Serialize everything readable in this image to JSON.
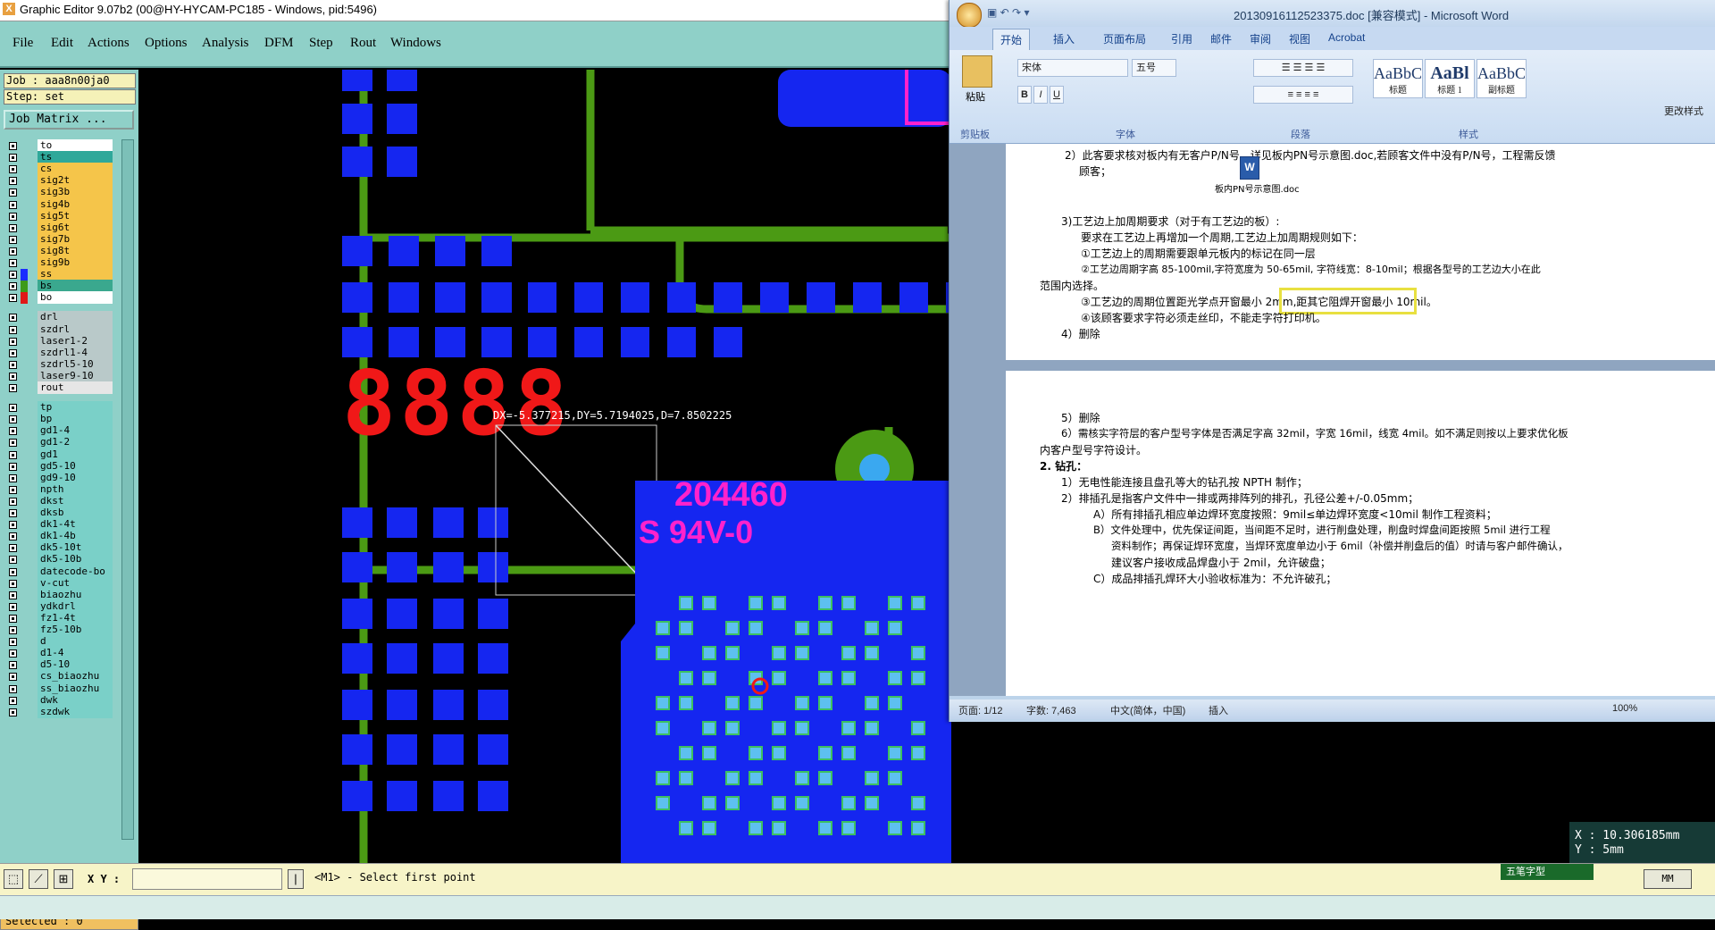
{
  "graphic_editor": {
    "title": "Graphic Editor 9.07b2 (00@HY-HYCAM-PC185 - Windows, pid:5496)",
    "menu": [
      "File",
      "Edit",
      "Actions",
      "Options",
      "Analysis",
      "DFM",
      "Step",
      "Rout",
      "Windows"
    ],
    "job": "Job : aaa8n00ja0",
    "step": "Step: set",
    "job_matrix_label": "Job Matrix ...",
    "layers_group1": [
      {
        "name": "to",
        "color": "#ffffff",
        "swatch": ""
      },
      {
        "name": "ts",
        "color": "#2fa89a",
        "swatch": ""
      },
      {
        "name": "cs",
        "color": "#f5c54a",
        "swatch": ""
      },
      {
        "name": "sig2t",
        "color": "#f5c54a",
        "swatch": ""
      },
      {
        "name": "sig3b",
        "color": "#f5c54a",
        "swatch": ""
      },
      {
        "name": "sig4b",
        "color": "#f5c54a",
        "swatch": ""
      },
      {
        "name": "sig5t",
        "color": "#f5c54a",
        "swatch": ""
      },
      {
        "name": "sig6t",
        "color": "#f5c54a",
        "swatch": ""
      },
      {
        "name": "sig7b",
        "color": "#f5c54a",
        "swatch": ""
      },
      {
        "name": "sig8t",
        "color": "#f5c54a",
        "swatch": ""
      },
      {
        "name": "sig9b",
        "color": "#f5c54a",
        "swatch": ""
      },
      {
        "name": "ss",
        "color": "#f5c54a",
        "swatch": "#1a2cff"
      },
      {
        "name": "bs",
        "color": "#3aa88e",
        "swatch": "#3d9a1a"
      },
      {
        "name": "bo",
        "color": "#ffffff",
        "swatch": "#e01818"
      }
    ],
    "layers_group2": [
      {
        "name": "drl",
        "color": "#b9c9c9"
      },
      {
        "name": "szdrl",
        "color": "#b9c9c9"
      },
      {
        "name": "laser1-2",
        "color": "#b9c9c9"
      },
      {
        "name": "szdrl1-4",
        "color": "#b9c9c9"
      },
      {
        "name": "szdrl5-10",
        "color": "#b9c9c9"
      },
      {
        "name": "laser9-10",
        "color": "#b9c9c9"
      },
      {
        "name": "rout",
        "color": "#e6e6e6"
      }
    ],
    "layers_group3": [
      {
        "name": "tp"
      },
      {
        "name": "bp"
      },
      {
        "name": "gd1-4"
      },
      {
        "name": "gd1-2"
      },
      {
        "name": "gd1"
      },
      {
        "name": "gd5-10"
      },
      {
        "name": "gd9-10"
      },
      {
        "name": "npth"
      },
      {
        "name": "dkst"
      },
      {
        "name": "dksb"
      },
      {
        "name": "dk1-4t"
      },
      {
        "name": "dk1-4b"
      },
      {
        "name": "dk5-10t"
      },
      {
        "name": "dk5-10b"
      },
      {
        "name": "datecode-bo"
      },
      {
        "name": "v-cut"
      },
      {
        "name": "biaozhu"
      },
      {
        "name": "ydkdrl"
      },
      {
        "name": "fz1-4t"
      },
      {
        "name": "fz5-10b"
      },
      {
        "name": "d"
      },
      {
        "name": "d1-4"
      },
      {
        "name": "d5-10"
      },
      {
        "name": "cs_biaozhu"
      },
      {
        "name": "ss_biaozhu"
      },
      {
        "name": "dwk"
      },
      {
        "name": "szdwk"
      }
    ],
    "selected": "Selected : 0",
    "measure_text": "DX=-5.377215,DY=5.7194025,D=7.8502225",
    "segment_text": "8888",
    "silk_text_1": "204460",
    "silk_text_2": "S 94V-0",
    "xy_label": "X Y :",
    "xy_value": "",
    "prompt": "<M1> - Select first point",
    "coord_x": "X : 10.306185mm",
    "coord_y": "Y : 5mm",
    "units": "MM",
    "ime": "五笔字型"
  },
  "word": {
    "title": "20130916112523375.doc [兼容模式] - Microsoft Word",
    "tabs": [
      "开始",
      "插入",
      "页面布局",
      "引用",
      "邮件",
      "审阅",
      "视图",
      "Acrobat"
    ],
    "font_name": "宋体",
    "font_size": "五号",
    "paste_label": "粘贴",
    "groups": [
      "剪贴板",
      "字体",
      "段落",
      "样式"
    ],
    "styles": [
      {
        "sample": "AaBbC",
        "label": "标题"
      },
      {
        "sample": "AaBl",
        "label": "标题 1"
      },
      {
        "sample": "AaBbC",
        "label": "副标题"
      }
    ],
    "change_styles": "更改样式",
    "doc_lines": [
      "2）此客要求核对板内有无客户P/N号，详见板内PN号示意图.doc,若顾客文件中没有P/N号，工程需反馈",
      "顾客；",
      "板内PN号示意图.doc",
      "3)工艺边上加周期要求（对于有工艺边的板）:",
      "要求在工艺边上再增加一个周期,工艺边上加周期规则如下：",
      "①工艺边上的周期需要跟单元板内的标记在同一层",
      "②工艺边周期字高 85-100mil,字符宽度为 50-65mil, 字符线宽：8-10mil；根据各型号的工艺边大小在此",
      "范围内选择。",
      "③工艺边的周期位置距光学点开窗最小 2mm,距其它阻焊开窗最小 10mil。",
      "④该顾客要求字符必须走丝印，不能走字符打印机。",
      "4）删除",
      "5）删除",
      "6）需核实字符层的客户型号字体是否满足字高 32mil，字宽 16mil，线宽 4mil。如不满足则按以上要求优化板",
      "内客户型号字符设计。",
      "2.    钻孔：",
      "1）无电性能连接且盘孔等大的钻孔按 NPTH 制作；",
      "2）排插孔是指客户文件中一排或两排阵列的排孔，孔径公差+/-0.05mm；",
      "A）所有排插孔相应单边焊环宽度按照：9mil≤单边焊环宽度<10mil 制作工程资料；",
      "B）文件处理中，优先保证间距，当间距不足时，进行削盘处理，削盘时焊盘间距按照 5mil 进行工程",
      "资料制作；再保证焊环宽度，当焊环宽度单边小于 6mil（补偿并削盘后的值）时请与客户邮件确认，",
      "建议客户接收成品焊盘小于 2mil，允许破盘；",
      "C）成品排插孔焊环大小验收标准为：不允许破孔；"
    ],
    "status": {
      "page": "页面: 1/12",
      "words": "字数: 7,463",
      "lang": "中文(简体，中国)",
      "mode": "插入",
      "zoom": "100%"
    }
  }
}
